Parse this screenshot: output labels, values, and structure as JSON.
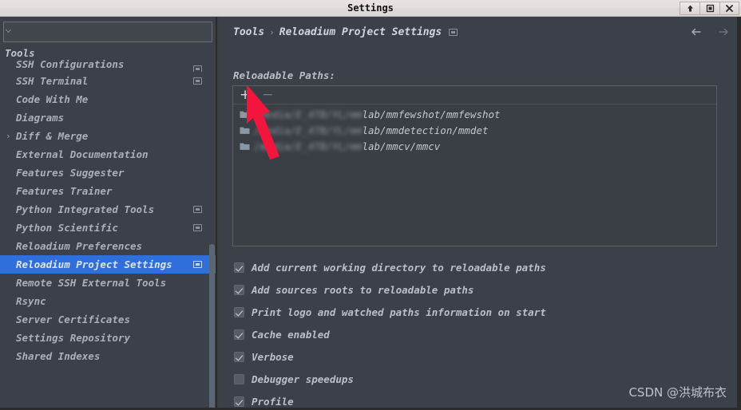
{
  "window": {
    "title": "Settings",
    "controls": [
      {
        "name": "minimize-button",
        "glyph": "up-arrow-icon"
      },
      {
        "name": "maximize-button",
        "glyph": "maximize-icon"
      },
      {
        "name": "close-button",
        "glyph": "close-icon"
      }
    ]
  },
  "search": {
    "value": "",
    "placeholder": ""
  },
  "sidebar": {
    "group_header": "Tools",
    "items": [
      {
        "label": "SSH Configurations",
        "badge": true,
        "caret": false,
        "selected": false,
        "clipped": true
      },
      {
        "label": "SSH Terminal",
        "badge": true,
        "caret": false,
        "selected": false
      },
      {
        "label": "Code With Me",
        "badge": false,
        "caret": false,
        "selected": false
      },
      {
        "label": "Diagrams",
        "badge": false,
        "caret": false,
        "selected": false
      },
      {
        "label": "Diff & Merge",
        "badge": false,
        "caret": true,
        "selected": false
      },
      {
        "label": "External Documentation",
        "badge": false,
        "caret": false,
        "selected": false
      },
      {
        "label": "Features Suggester",
        "badge": false,
        "caret": false,
        "selected": false
      },
      {
        "label": "Features Trainer",
        "badge": false,
        "caret": false,
        "selected": false
      },
      {
        "label": "Python Integrated Tools",
        "badge": true,
        "caret": false,
        "selected": false
      },
      {
        "label": "Python Scientific",
        "badge": true,
        "caret": false,
        "selected": false
      },
      {
        "label": "Reloadium Preferences",
        "badge": false,
        "caret": false,
        "selected": false
      },
      {
        "label": "Reloadium Project Settings",
        "badge": true,
        "caret": false,
        "selected": true
      },
      {
        "label": "Remote SSH External Tools",
        "badge": false,
        "caret": false,
        "selected": false
      },
      {
        "label": "Rsync",
        "badge": false,
        "caret": false,
        "selected": false
      },
      {
        "label": "Server Certificates",
        "badge": false,
        "caret": false,
        "selected": false
      },
      {
        "label": "Settings Repository",
        "badge": false,
        "caret": false,
        "selected": false
      },
      {
        "label": "Shared Indexes",
        "badge": false,
        "caret": false,
        "selected": false
      }
    ]
  },
  "main": {
    "breadcrumb": {
      "root": "Tools",
      "separator": "›",
      "current": "Reloadium Project Settings"
    },
    "nav": {
      "back_label": "back-arrow",
      "forward_label": "forward-arrow"
    },
    "section_label": "Reloadable Paths:",
    "list_toolbar": {
      "add_label": "+",
      "remove_label": "−"
    },
    "paths": [
      {
        "redacted_prefix": "/media/E_4TB/YL/mm",
        "visible_suffix": "lab/mmfewshot/mmfewshot"
      },
      {
        "redacted_prefix": "/media/E_4TB/YL/mm",
        "visible_suffix": "lab/mmdetection/mmdet"
      },
      {
        "redacted_prefix": "/media/E_4TB/YL/mm",
        "visible_suffix": "lab/mmcv/mmcv"
      }
    ],
    "options": [
      {
        "label": "Add current working directory to reloadable paths",
        "checked": true
      },
      {
        "label": "Add sources roots to reloadable paths",
        "checked": true
      },
      {
        "label": "Print logo and watched paths information on start",
        "checked": true
      },
      {
        "label": "Cache enabled",
        "checked": true
      },
      {
        "label": "Verbose",
        "checked": true
      },
      {
        "label": "Debugger speedups",
        "checked": false
      },
      {
        "label": "Profile",
        "checked": true
      }
    ]
  },
  "watermark": "CSDN @洪城布衣",
  "colors": {
    "accent_selection": "#2f6fdb",
    "panel_background": "#3c4048",
    "list_background": "#3a3e45",
    "titlebar": "#e4dedc",
    "text_primary": "#b9c0ca",
    "annotation_arrow": "#f5143c"
  }
}
